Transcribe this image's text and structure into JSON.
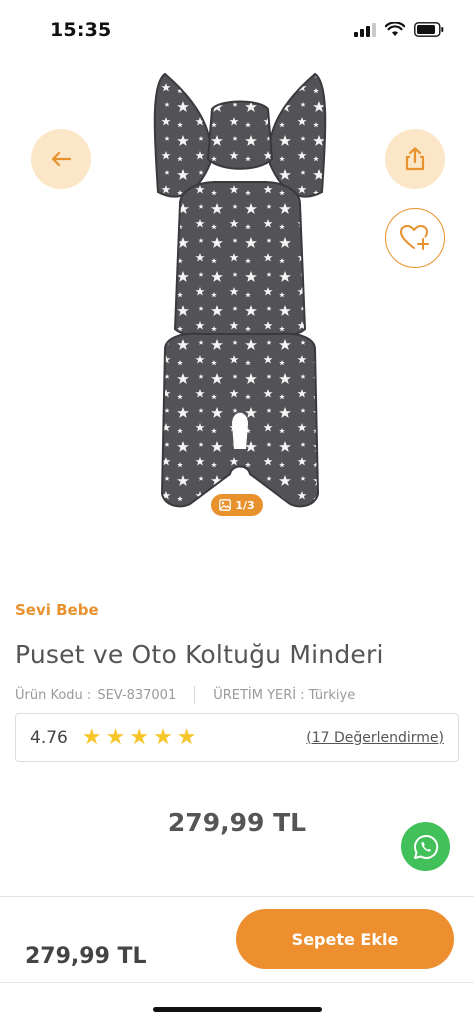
{
  "status_bar": {
    "time": "15:35"
  },
  "gallery": {
    "page_indicator": "1/3",
    "image_alt": "Star patterned grey stroller and car seat cushion"
  },
  "icons": {
    "back": "arrow-left-icon",
    "share": "share-icon",
    "favorite": "heart-plus-icon",
    "whatsapp": "whatsapp-icon"
  },
  "product": {
    "brand": "Sevi Bebe",
    "title": "Puset ve Oto Koltuğu Minderi",
    "code_label": "Ürün Kodu :",
    "code_value": "SEV-837001",
    "origin_label": "ÜRETİM YERİ :",
    "origin_value": "Türkiye",
    "rating": "4.76",
    "stars": 5,
    "reviews": "(17 Değerlendirme)",
    "price": "279,99 TL"
  },
  "footer": {
    "price": "279,99 TL",
    "add_to_cart": "Sepete Ekle"
  },
  "colors": {
    "accent": "#e8922e",
    "button": "#ee8f2f",
    "star": "#f6c62a",
    "whatsapp": "#42c05a"
  }
}
